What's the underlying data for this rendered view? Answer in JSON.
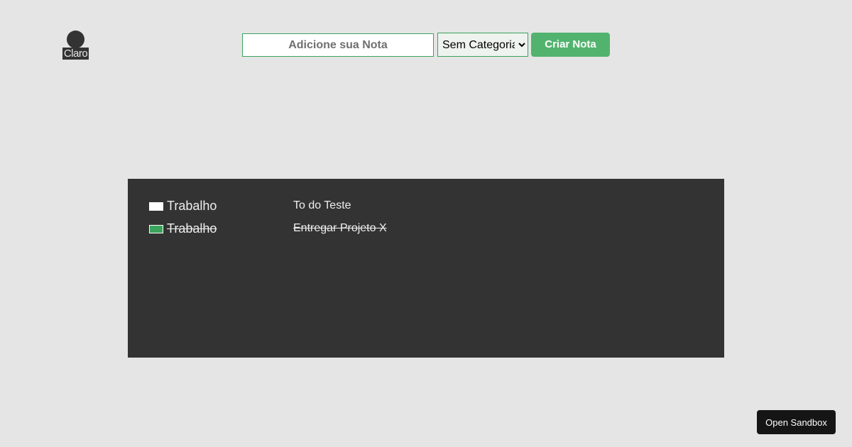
{
  "theme_toggle": {
    "label": "Claro",
    "icon": "circle-icon"
  },
  "form": {
    "note_input": {
      "value": "",
      "placeholder": "Adicione sua Nota"
    },
    "category_select": {
      "selected": "Sem Categoria"
    },
    "create_button_label": "Criar Nota"
  },
  "notes": [
    {
      "category": "Trabalho",
      "text": "To do Teste",
      "done": false,
      "swatch_color": "#ffffff"
    },
    {
      "category": "Trabalho",
      "text": "Entregar Projeto X",
      "done": true,
      "swatch_color": "#3aa35c"
    }
  ],
  "sandbox_button_label": "Open Sandbox",
  "colors": {
    "background": "#e5e5e5",
    "panel": "#333333",
    "accent_green": "#52b36f",
    "border_green": "#3aa35c"
  }
}
